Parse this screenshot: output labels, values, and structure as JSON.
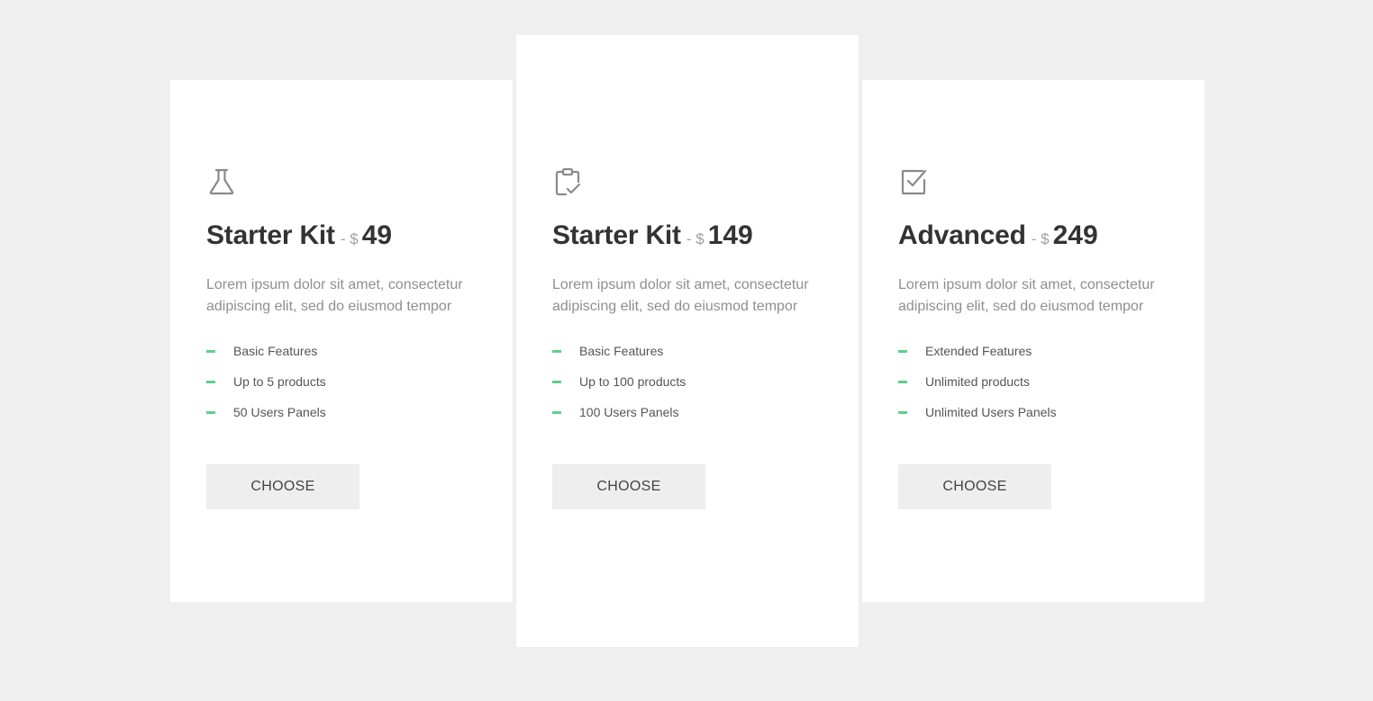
{
  "plans": [
    {
      "icon": "flask-icon",
      "name": "Starter Kit",
      "separator": "- $",
      "price": "49",
      "description": "Lorem ipsum dolor sit amet, consectetur adipiscing elit, sed do eiusmod tempor",
      "features": [
        "Basic Features",
        "Up to 5 products",
        "50 Users Panels"
      ],
      "button_label": "CHOOSE"
    },
    {
      "icon": "clipboard-check-icon",
      "name": "Starter Kit",
      "separator": "- $",
      "price": "149",
      "description": "Lorem ipsum dolor sit amet, consectetur adipiscing elit, sed do eiusmod tempor",
      "features": [
        "Basic Features",
        "Up to 100 products",
        "100 Users Panels"
      ],
      "button_label": "CHOOSE"
    },
    {
      "icon": "checkbox-checked-icon",
      "name": "Advanced",
      "separator": "- $",
      "price": "249",
      "description": "Lorem ipsum dolor sit amet, consectetur adipiscing elit, sed do eiusmod tempor",
      "features": [
        "Extended Features",
        "Unlimited products",
        "Unlimited Users Panels"
      ],
      "button_label": "CHOOSE"
    }
  ],
  "colors": {
    "background": "#efefef",
    "card": "#ffffff",
    "accent_dash": "#5fcf8f",
    "title": "#333333",
    "muted": "#8f8f8f",
    "button_bg": "#eeeeee"
  }
}
